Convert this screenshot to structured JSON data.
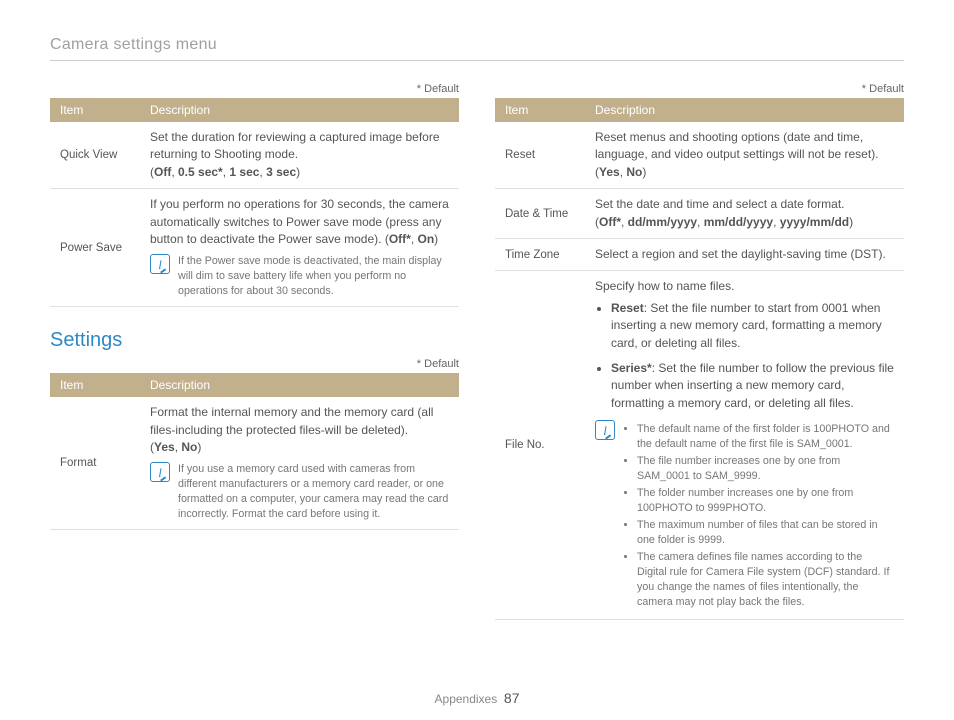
{
  "pageTitle": "Camera settings menu",
  "defaultTag": "* Default",
  "headers": {
    "item": "Item",
    "desc": "Description"
  },
  "sectionTitle": "Settings",
  "footer": {
    "label": "Appendixes",
    "page": "87"
  },
  "t1": {
    "r1": {
      "item": "Quick View",
      "desc": "Set the duration for reviewing a captured image before returning to Shooting mode.",
      "opts": [
        "Off",
        "0.5 sec*",
        "1 sec",
        "3 sec"
      ]
    },
    "r2": {
      "item": "Power Save",
      "desc": "If you perform no operations for 30 seconds, the camera automatically switches to Power save mode (press any button to deactivate the Power save mode).",
      "opts": [
        "Off*",
        "On"
      ],
      "note": "If the Power save mode is deactivated, the main display will dim to save battery life when you perform no operations for about 30 seconds."
    }
  },
  "t2": {
    "r1": {
      "item": "Format",
      "desc": "Format the internal memory and the memory card (all files-including the protected files-will be deleted).",
      "opts": [
        "Yes",
        "No"
      ],
      "note": "If you use a memory card used with cameras from different manufacturers or a memory card reader, or one formatted on a computer, your camera may read the card incorrectly. Format the card before using it."
    }
  },
  "t3": {
    "r1": {
      "item": "Reset",
      "desc": "Reset menus and shooting options (date and time, language, and video output settings will not be reset).",
      "opts": [
        "Yes",
        "No"
      ]
    },
    "r2": {
      "item": "Date & Time",
      "desc": "Set the date and time and select a date format.",
      "opts": [
        "Off*",
        "dd/mm/yyyy",
        "mm/dd/yyyy",
        "yyyy/mm/dd"
      ]
    },
    "r3": {
      "item": "Time Zone",
      "desc": "Select a region and set the daylight-saving time (DST)."
    },
    "r4": {
      "item": "File No.",
      "intro": "Specify how to name files.",
      "b1": {
        "label": "Reset",
        "text": ": Set the file number to start from 0001 when inserting a new memory card, formatting a memory card, or deleting all files."
      },
      "b2": {
        "label": "Series*",
        "text": ": Set the file number to follow the previous file number when inserting a new memory card, formatting a memory card, or deleting all files."
      },
      "notes": [
        "The default name of the first folder is 100PHOTO and the default name of the first file is SAM_0001.",
        "The file number increases one by one from SAM_0001 to SAM_9999.",
        "The folder number increases one by one from 100PHOTO to 999PHOTO.",
        "The maximum number of files that can be stored in one folder is 9999.",
        "The camera defines file names according to the Digital rule for Camera File system (DCF) standard. If you change the names of files intentionally, the camera may not play back the files."
      ]
    }
  }
}
